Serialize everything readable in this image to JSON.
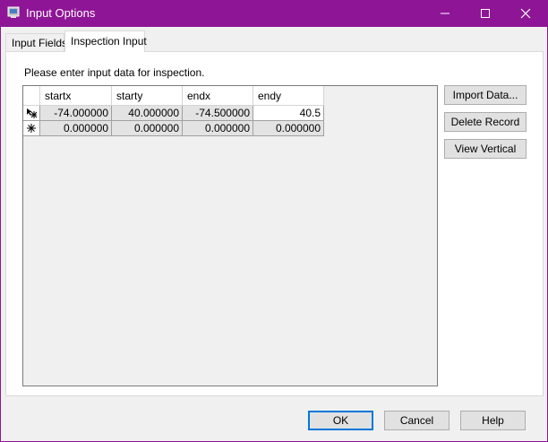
{
  "window": {
    "title": "Input Options",
    "accent": "#8e1596",
    "icons": [
      "app-icon",
      "minimize-icon",
      "maximize-icon",
      "close-icon"
    ]
  },
  "tabs": [
    {
      "label": "Input Fields",
      "active": false
    },
    {
      "label": "Inspection Input",
      "active": true
    }
  ],
  "panel": {
    "prompt": "Please enter input data for inspection."
  },
  "grid": {
    "columns": [
      "startx",
      "starty",
      "endx",
      "endy"
    ],
    "rows": [
      {
        "marker": "edit-new-row-icon",
        "cells": [
          "-74.000000",
          "40.000000",
          "-74.500000",
          "40.5"
        ]
      },
      {
        "marker": "new-row-asterisk-icon",
        "cells": [
          "0.000000",
          "0.000000",
          "0.000000",
          "0.000000"
        ]
      }
    ]
  },
  "side_buttons": {
    "import": "Import Data...",
    "delete": "Delete Record",
    "view_vertical": "View Vertical"
  },
  "footer": {
    "ok": "OK",
    "cancel": "Cancel",
    "help": "Help"
  }
}
